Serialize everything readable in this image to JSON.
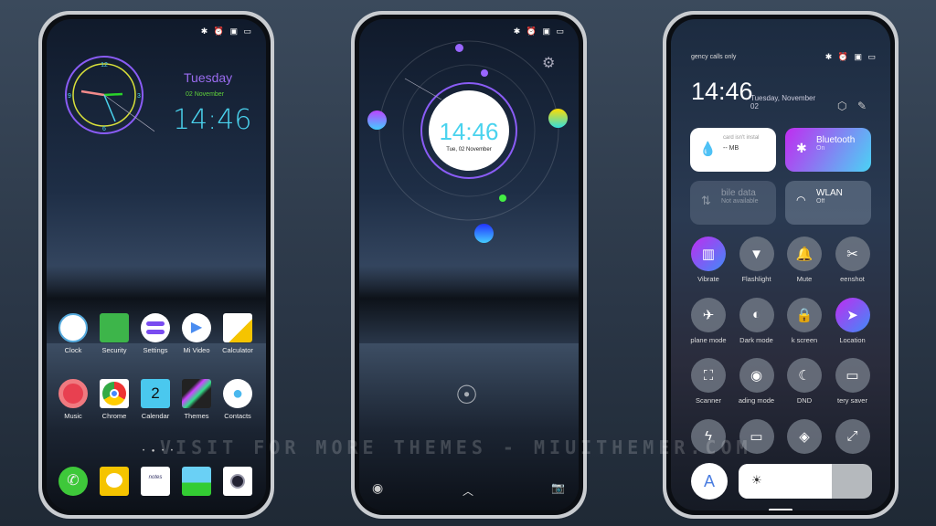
{
  "status_icons": "✱ ⏰ ▣ ▭",
  "phone1": {
    "day": "Tuesday",
    "date": "02 November",
    "time": "14:46",
    "clock_numbers": [
      "12",
      "3",
      "6",
      "9"
    ],
    "apps": [
      {
        "label": "Clock",
        "icon": "clock-icon"
      },
      {
        "label": "Security",
        "icon": "shield-icon"
      },
      {
        "label": "Settings",
        "icon": "settings-icon"
      },
      {
        "label": "Mi Video",
        "icon": "play-icon"
      },
      {
        "label": "Calculator",
        "icon": "calculator-icon"
      },
      {
        "label": "Music",
        "icon": "music-icon"
      },
      {
        "label": "Chrome",
        "icon": "chrome-icon"
      },
      {
        "label": "Calendar",
        "icon": "calendar-icon",
        "badge": "2"
      },
      {
        "label": "Themes",
        "icon": "themes-icon"
      },
      {
        "label": "Contacts",
        "icon": "contacts-icon"
      }
    ],
    "dock": [
      "phone-icon",
      "messages-icon",
      "notes-icon",
      "gallery-icon",
      "camera-icon"
    ],
    "notes_text": "notes"
  },
  "phone2": {
    "time": "14:46",
    "date": "Tue, 02 November"
  },
  "phone3": {
    "carrier": "gency calls only",
    "time": "14:46",
    "date_line1": "Tuesday, November",
    "date_line2": "02",
    "tiles": [
      {
        "title": "card isn't instal",
        "sub": "-- MB",
        "icon": "water-drop-icon"
      },
      {
        "title": "Bluetooth",
        "sub": "On",
        "icon": "bluetooth-icon"
      },
      {
        "title": "bile data",
        "sub": "Not available",
        "icon": "mobile-data-icon"
      },
      {
        "title": "WLAN",
        "sub": "Off",
        "icon": "wifi-icon"
      }
    ],
    "toggles": [
      {
        "label": "Vibrate",
        "glyph": "▥",
        "active": true
      },
      {
        "label": "Flashlight",
        "glyph": "▼",
        "active": false
      },
      {
        "label": "Mute",
        "glyph": "🔔",
        "active": false
      },
      {
        "label": "eenshot",
        "glyph": "✂",
        "active": false
      },
      {
        "label": "plane mode",
        "glyph": "✈",
        "active": false
      },
      {
        "label": "Dark mode",
        "glyph": "◐",
        "active": false
      },
      {
        "label": "k screen",
        "glyph": "🔒",
        "active": false
      },
      {
        "label": "Location",
        "glyph": "➤",
        "active": true
      },
      {
        "label": "Scanner",
        "glyph": "⛶",
        "active": false
      },
      {
        "label": "ading mode",
        "glyph": "◉",
        "active": false
      },
      {
        "label": "DND",
        "glyph": "☾",
        "active": false
      },
      {
        "label": "tery saver",
        "glyph": "▭",
        "active": false
      },
      {
        "label": "",
        "glyph": "ϟ",
        "active": false
      },
      {
        "label": "",
        "glyph": "▭",
        "active": false
      },
      {
        "label": "",
        "glyph": "◈",
        "active": false
      },
      {
        "label": "",
        "glyph": "⤢",
        "active": false
      }
    ],
    "auto_brightness": "A",
    "brightness_level": 0.7
  },
  "watermark": "VISIT FOR MORE THEMES - MIUITHEMER.COM"
}
